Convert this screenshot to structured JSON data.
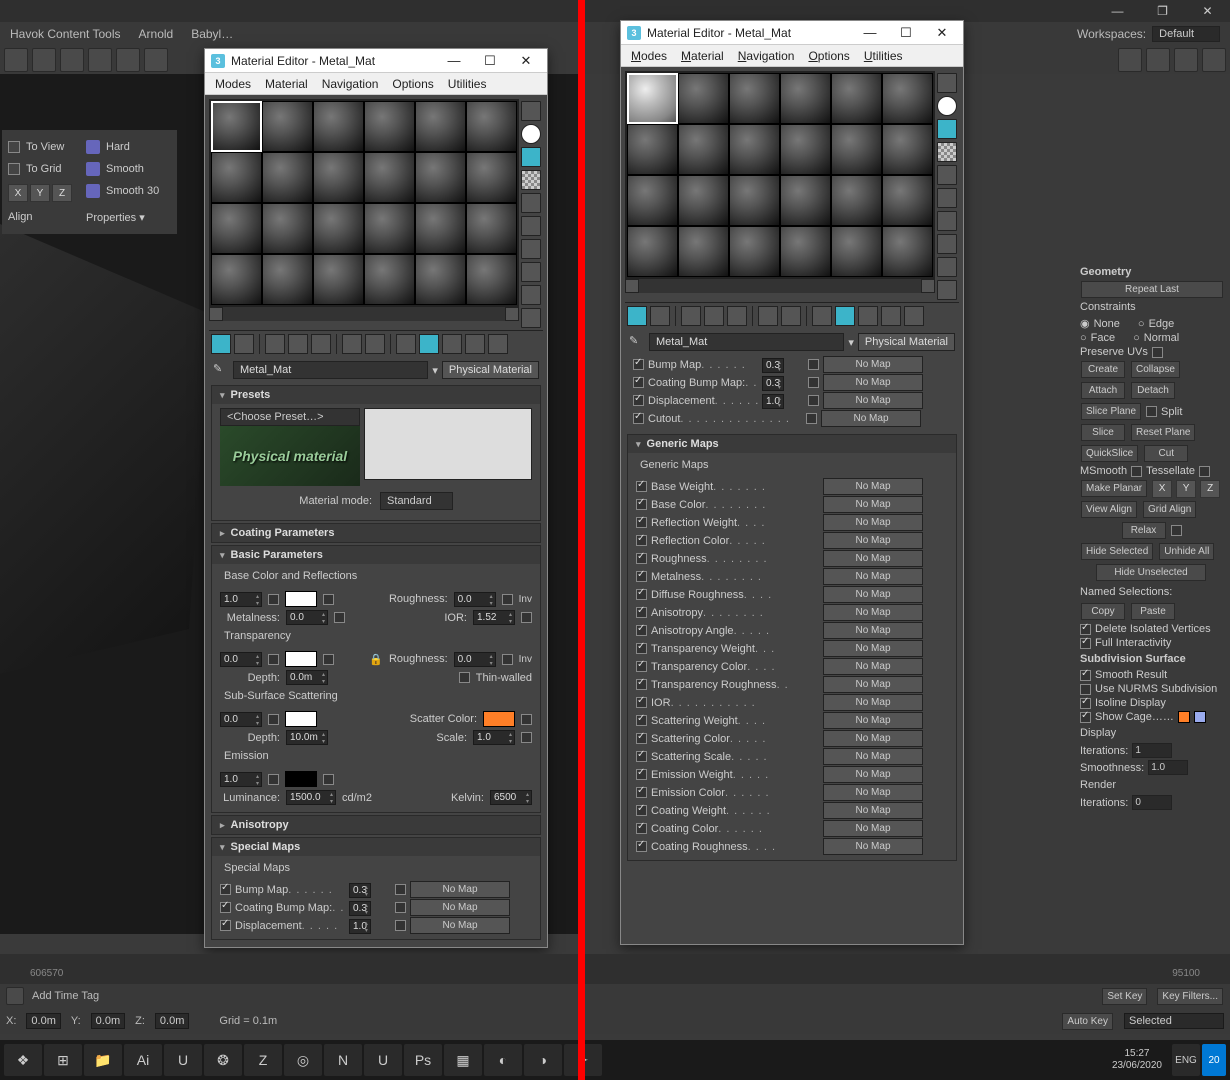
{
  "app": {
    "workspaces_label": "Workspaces:",
    "workspace": "Default",
    "menubar_items": [
      "Havok Content Tools",
      "Arnold",
      "Babyl…"
    ]
  },
  "side": {
    "to_view": "To View",
    "to_grid": "To Grid",
    "align": "Align",
    "hard": "Hard",
    "smooth": "Smooth",
    "smooth30": "Smooth 30",
    "x": "X",
    "y": "Y",
    "z": "Z",
    "properties": "Properties ▾"
  },
  "right": {
    "geometry": "Geometry",
    "repeat": "Repeat Last",
    "constraints": "Constraints",
    "none": "None",
    "edge": "Edge",
    "face": "Face",
    "normal": "Normal",
    "preserve": "Preserve UVs",
    "create": "Create",
    "collapse": "Collapse",
    "attach": "Attach",
    "detach": "Detach",
    "slice_plane": "Slice Plane",
    "split": "Split",
    "slice": "Slice",
    "reset_plane": "Reset Plane",
    "quickslice": "QuickSlice",
    "cut": "Cut",
    "msmooth": "MSmooth",
    "tessellate": "Tessellate",
    "make_planar": "Make Planar",
    "view_align": "View Align",
    "grid_align": "Grid Align",
    "relax": "Relax",
    "hide_sel": "Hide Selected",
    "unhide": "Unhide All",
    "hide_unsel": "Hide Unselected",
    "named_sel": "Named Selections:",
    "copy": "Copy",
    "paste": "Paste",
    "del_iso": "Delete Isolated Vertices",
    "full_int": "Full Interactivity",
    "subdiv": "Subdivision Surface",
    "smooth_res": "Smooth Result",
    "nurms": "Use NURMS Subdivision",
    "isoline": "Isoline Display",
    "show_cage": "Show Cage……",
    "display": "Display",
    "iterations": "Iterations:",
    "it_val": "1",
    "smoothness": "Smoothness:",
    "sm_val": "1.0",
    "render": "Render",
    "rit_val": "0"
  },
  "me": {
    "title": "Material Editor - Metal_Mat",
    "menu": {
      "modes": "Modes",
      "material": "Material",
      "navigation": "Navigation",
      "options": "Options",
      "utilities": "Utilities"
    },
    "mat_name": "Metal_Mat",
    "mat_type": "Physical Material",
    "presets": {
      "hdr": "Presets",
      "choose": "<Choose Preset…>",
      "brand": "Physical material",
      "mm_label": "Material mode:",
      "mm_value": "Standard"
    },
    "coating_hdr": "Coating Parameters",
    "basic": {
      "hdr": "Basic Parameters",
      "bcr": "Base Color and Reflections",
      "weight": "1.0",
      "rough_lbl": "Roughness:",
      "rough": "0.0",
      "inv": "Inv",
      "metal_lbl": "Metalness:",
      "metal": "0.0",
      "ior_lbl": "IOR:",
      "ior": "1.52",
      "trans_hdr": "Transparency",
      "trans": "0.0",
      "trough_lbl": "Roughness:",
      "trough": "0.0",
      "depth_lbl": "Depth:",
      "depth": "0.0m",
      "thin": "Thin-walled",
      "sss_hdr": "Sub-Surface Scattering",
      "sss": "0.0",
      "scatter_lbl": "Scatter Color:",
      "sdepth": "10.0m",
      "scale_lbl": "Scale:",
      "scale": "1.0",
      "em_hdr": "Emission",
      "em": "1.0",
      "lum_lbl": "Luminance:",
      "lum": "1500.0",
      "lum_unit": "cd/m2",
      "kelvin_lbl": "Kelvin:",
      "kelvin": "6500"
    },
    "aniso_hdr": "Anisotropy",
    "smaps": {
      "hdr": "Special Maps",
      "sub": "Special Maps",
      "bump": "Bump Map",
      "bump_v": "0.3",
      "cbump": "Coating Bump Map:",
      "cbump_v": "0.3",
      "disp": "Displacement",
      "disp_v": "1.0",
      "cutout": "Cutout",
      "nomap": "No Map"
    },
    "gmaps": {
      "hdr": "Generic Maps",
      "sub": "Generic Maps",
      "nomap": "No Map",
      "items": [
        "Base Weight",
        "Base Color",
        "Reflection Weight",
        "Reflection Color",
        "Roughness",
        "Metalness",
        "Diffuse Roughness",
        "Anisotropy",
        "Anisotropy Angle",
        "Transparency Weight",
        "Transparency Color",
        "Transparency Roughness",
        "IOR",
        "Scattering Weight",
        "Scattering Color",
        "Scattering Scale",
        "Emission Weight",
        "Emission Color",
        "Coating Weight",
        "Coating Color",
        "Coating Roughness"
      ]
    }
  },
  "status": {
    "x": "X:",
    "xv": "0.0m",
    "y": "Y:",
    "yv": "0.0m",
    "z": "Z:",
    "zv": "0.0m",
    "grid": "Grid = 0.1m",
    "add_time": "Add Time Tag",
    "autokey": "Auto Key",
    "setkey": "Set Key",
    "selected": "Selected",
    "keyfilters": "Key Filters..."
  },
  "timeline": {
    "ticks": [
      "60",
      "65",
      "70",
      "95",
      "100"
    ]
  },
  "tray": {
    "lang": "ENG",
    "time": "15:27",
    "date": "23/06/2020",
    "notif": "20"
  }
}
